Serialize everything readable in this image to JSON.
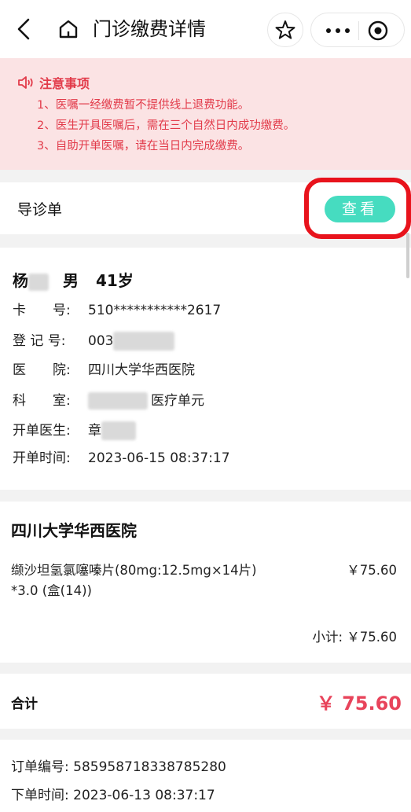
{
  "header": {
    "title": "门诊缴费详情",
    "back_icon": "chevron-left-icon",
    "home_icon": "home-icon",
    "star_icon": "star-icon",
    "more_icon": "more-icon",
    "target_icon": "target-icon"
  },
  "notice": {
    "title": "注意事项",
    "icon": "speaker-icon",
    "lines": [
      "1、医嘱一经缴费暂不提供线上退费功能。",
      "2、医生开具医嘱后，需在三个自然日内成功缴费。",
      "3、自助开单医嘱，请在当日内完成缴费。"
    ],
    "color": "#e23b4a"
  },
  "guide": {
    "label": "导诊单",
    "view_button": "查看",
    "button_color": "#46dcc0"
  },
  "patient": {
    "surname": "杨",
    "gender": "男",
    "age": "41岁",
    "card_label": "卡　　号:",
    "card_value": "510***********2617",
    "reg_label": "登 记 号:",
    "reg_value": "003",
    "hospital_label": "医　　院:",
    "hospital_value": "四川大学华西医院",
    "dept_label": "科　　室:",
    "dept_value": "医疗单元",
    "doctor_label": "开单医生:",
    "doctor_value": "章",
    "time_label": "开单时间:",
    "time_value": "2023-06-15 08:37:17"
  },
  "order_items": {
    "hospital": "四川大学华西医院",
    "drug_name": "缬沙坦氢氯噻嗪片(80mg:12.5mg×14片) *3.0 (盒(14))",
    "drug_price": "￥75.60",
    "subtotal": "小计: ￥75.60"
  },
  "total": {
    "label": "合计",
    "value": "￥ 75.60",
    "color": "#e8445b"
  },
  "order_info": {
    "number_label": "订单编号:",
    "number_value": "585958718338785280",
    "time_label": "下单时间:",
    "time_value": "2023-06-13 08:37:17"
  }
}
